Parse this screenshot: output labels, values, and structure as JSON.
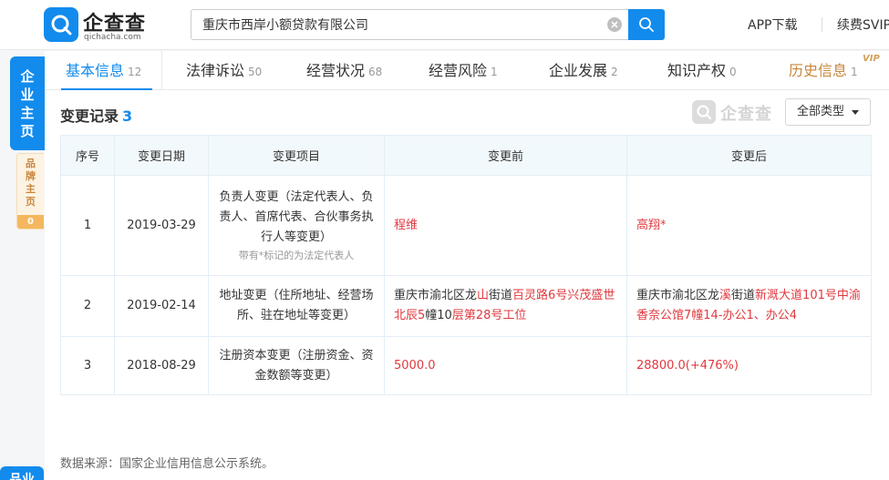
{
  "header": {
    "logo_title": "企查查",
    "logo_sub": "qichacha.com",
    "search_value": "重庆市西岸小额贷款有限公司",
    "app_download": "APP下载",
    "renew_svip": "续费SVIP"
  },
  "side_tabs": {
    "main": [
      "企",
      "业",
      "主",
      "页"
    ],
    "brand": [
      "品",
      "牌",
      "主",
      "页"
    ],
    "brand_count": "0",
    "bottom": "品业"
  },
  "tabs": [
    {
      "label": "基本信息",
      "count": "12"
    },
    {
      "label": "法律诉讼",
      "count": "50"
    },
    {
      "label": "经营状况",
      "count": "68"
    },
    {
      "label": "经营风险",
      "count": "1"
    },
    {
      "label": "企业发展",
      "count": "2"
    },
    {
      "label": "知识产权",
      "count": "0"
    },
    {
      "label": "历史信息",
      "count": "1"
    }
  ],
  "vip_badge": "VIP",
  "section": {
    "title": "变更记录",
    "count": "3",
    "watermark": "企查查",
    "filter_label": "全部类型"
  },
  "table": {
    "headers": [
      "序号",
      "变更日期",
      "变更项目",
      "变更前",
      "变更后"
    ],
    "rows": [
      {
        "index": "1",
        "date": "2019-03-29",
        "item": "负责人变更（法定代表人、负责人、首席代表、合伙事务执行人等变更）",
        "note": "带有*标记的为法定代表人",
        "before": [
          {
            "t": "程维",
            "h": true
          }
        ],
        "after": [
          {
            "t": "高翔*",
            "h": true
          }
        ]
      },
      {
        "index": "2",
        "date": "2019-02-14",
        "item": "地址变更（住所地址、经营场所、驻在地址等变更）",
        "note": "",
        "before": [
          {
            "t": "重庆市渝北区龙",
            "h": false
          },
          {
            "t": "山",
            "h": true
          },
          {
            "t": "街道",
            "h": false
          },
          {
            "t": "百灵路6号兴茂盛世北辰5",
            "h": true
          },
          {
            "t": "幢10",
            "h": false
          },
          {
            "t": "层第28号工位",
            "h": true
          }
        ],
        "after": [
          {
            "t": "重庆市渝北区龙",
            "h": false
          },
          {
            "t": "溪",
            "h": true
          },
          {
            "t": "街道",
            "h": false
          },
          {
            "t": "新溉大道101号中渝香奈公馆7",
            "h": true
          },
          {
            "t": "幢14-办公1、办公4",
            "h": true
          }
        ]
      },
      {
        "index": "3",
        "date": "2018-08-29",
        "item": "注册资本变更（注册资金、资金数额等变更）",
        "note": "",
        "before": [
          {
            "t": "5000.0",
            "h": true
          }
        ],
        "after": [
          {
            "t": "28800.0(+476%)",
            "h": true
          }
        ]
      }
    ]
  },
  "source": "数据来源：国家企业信用信息公示系统。",
  "colors": {
    "brand_blue": "#128bed",
    "highlight_red": "#e0393e",
    "history_gold": "#c8873c"
  }
}
